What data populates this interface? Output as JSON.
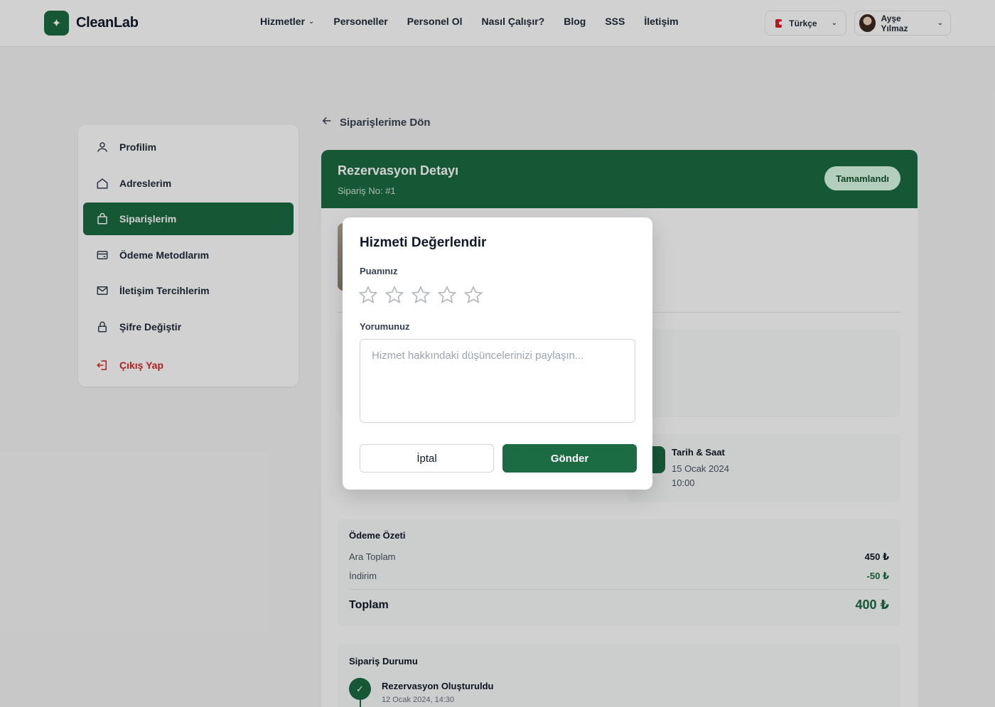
{
  "brand": {
    "name": "CleanLab",
    "logo_icon": "sparkle-icon"
  },
  "nav": {
    "items": [
      {
        "label": "Hizmetler",
        "has_dropdown": true
      },
      {
        "label": "Personeller"
      },
      {
        "label": "Personel Ol"
      },
      {
        "label": "Nasıl Çalışır?"
      },
      {
        "label": "Blog"
      },
      {
        "label": "SSS"
      },
      {
        "label": "İletişim"
      }
    ]
  },
  "language": {
    "label": "Türkçe",
    "flag": "tr-flag-icon"
  },
  "user": {
    "name": "Ayşe Yılmaz"
  },
  "sidebar": {
    "items": [
      {
        "label": "Profilim",
        "icon": "user-icon"
      },
      {
        "label": "Adreslerim",
        "icon": "home-icon"
      },
      {
        "label": "Siparişlerim",
        "icon": "shopping-bag-icon",
        "active": true
      },
      {
        "label": "Ödeme Metodlarım",
        "icon": "credit-card-icon"
      },
      {
        "label": "İletişim Tercihlerim",
        "icon": "mail-icon"
      },
      {
        "label": "Şifre Değiştir",
        "icon": "lock-icon"
      },
      {
        "label": "Çıkış Yap",
        "icon": "logout-icon"
      }
    ]
  },
  "back_link": "Siparişlerime Dön",
  "reservation": {
    "title": "Rezervasyon Detayı",
    "order_no": "Sipariş No: #1",
    "status": "Tamamlandı",
    "datetime": {
      "label": "Tarih & Saat",
      "date": "15 Ocak 2024",
      "time": "10:00"
    }
  },
  "payment": {
    "title": "Ödeme Özeti",
    "subtotal_label": "Ara Toplam",
    "subtotal": "450 ₺",
    "discount_label": "İndirim",
    "discount": "-50 ₺",
    "total_label": "Toplam",
    "total": "400 ₺"
  },
  "order_status": {
    "title": "Sipariş Durumu",
    "steps": [
      {
        "label": "Rezervasyon Oluşturuldu",
        "time": "12 Ocak 2024, 14:30"
      }
    ]
  },
  "modal": {
    "title": "Hizmeti Değerlendir",
    "rating_label": "Puanınız",
    "rating": 0,
    "rating_max": 5,
    "comment_label": "Yorumunuz",
    "comment_placeholder": "Hizmet hakkındaki düşüncelerinizi paylaşın...",
    "comment_value": "",
    "cancel_label": "İptal",
    "submit_label": "Gönder"
  },
  "colors": {
    "primary": "#1b6b43",
    "danger": "#dc2626",
    "overlay": "rgba(0,0,0,0.18)"
  }
}
